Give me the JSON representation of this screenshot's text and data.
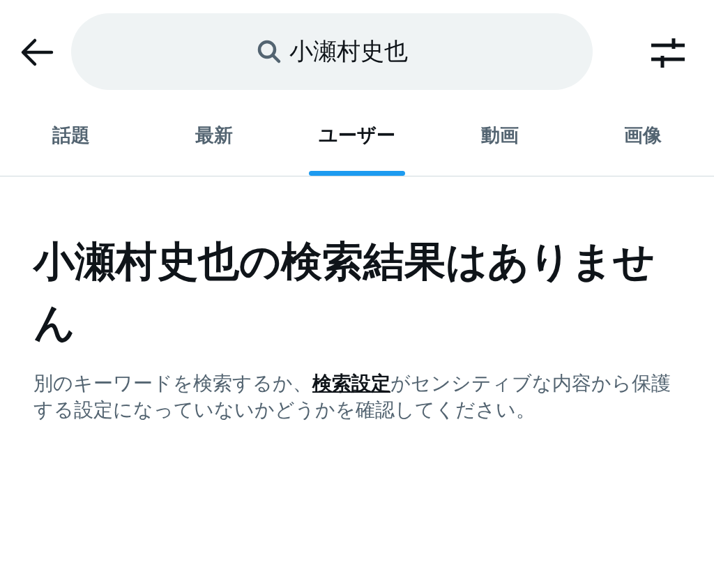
{
  "search": {
    "value": "小瀬村史也"
  },
  "tabs": [
    {
      "label": "話題",
      "selected": false
    },
    {
      "label": "最新",
      "selected": false
    },
    {
      "label": "ユーザー",
      "selected": true
    },
    {
      "label": "動画",
      "selected": false
    },
    {
      "label": "画像",
      "selected": false
    }
  ],
  "empty_state": {
    "heading": "小瀬村史也の検索結果はありません",
    "message_before": "別のキーワードを検索するか、",
    "message_link": "検索設定",
    "message_after": "がセンシティブな内容から保護する設定になっていないかどうかを確認してください。"
  }
}
